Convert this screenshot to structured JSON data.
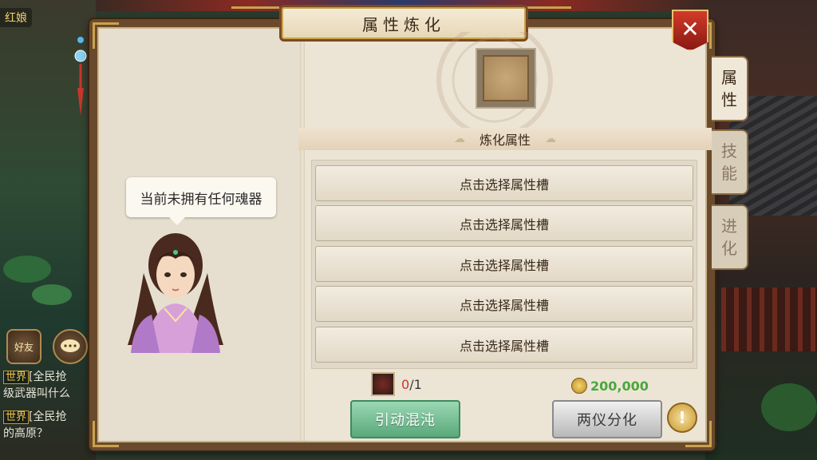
{
  "hud": {
    "player_name": "红娘",
    "friends_label": "好友",
    "chat": [
      {
        "channel": "世界",
        "text": "[全民抢",
        "continuation": "级武器叫什么"
      },
      {
        "channel": "世界",
        "text": "[全民抢",
        "continuation": "的高原？"
      }
    ]
  },
  "panel": {
    "title": "属性炼化",
    "close_label": "✕",
    "tabs": [
      {
        "label_top": "属",
        "label_bottom": "性",
        "active": true
      },
      {
        "label_top": "技",
        "label_bottom": "能",
        "active": false
      },
      {
        "label_top": "进",
        "label_bottom": "化",
        "active": false
      }
    ],
    "npc_message": "当前未拥有任何魂器",
    "section_title": "炼化属性",
    "attribute_slots": [
      "点击选择属性槽",
      "点击选择属性槽",
      "点击选择属性槽",
      "点击选择属性槽",
      "点击选择属性槽"
    ],
    "material": {
      "owned": "0",
      "required": "/1"
    },
    "cost": "200,000",
    "chaos_button": "引动混沌",
    "split_button": "两仪分化",
    "help_label": "!"
  },
  "colors": {
    "panel_bg": "#e9e2d3",
    "frame": "#6a4a2c",
    "accent_gold": "#c9a24e",
    "close_red": "#d23a2a",
    "chaos_green": "#5aa87a",
    "money_green": "#4aa83a",
    "count_red": "#c8372a"
  }
}
